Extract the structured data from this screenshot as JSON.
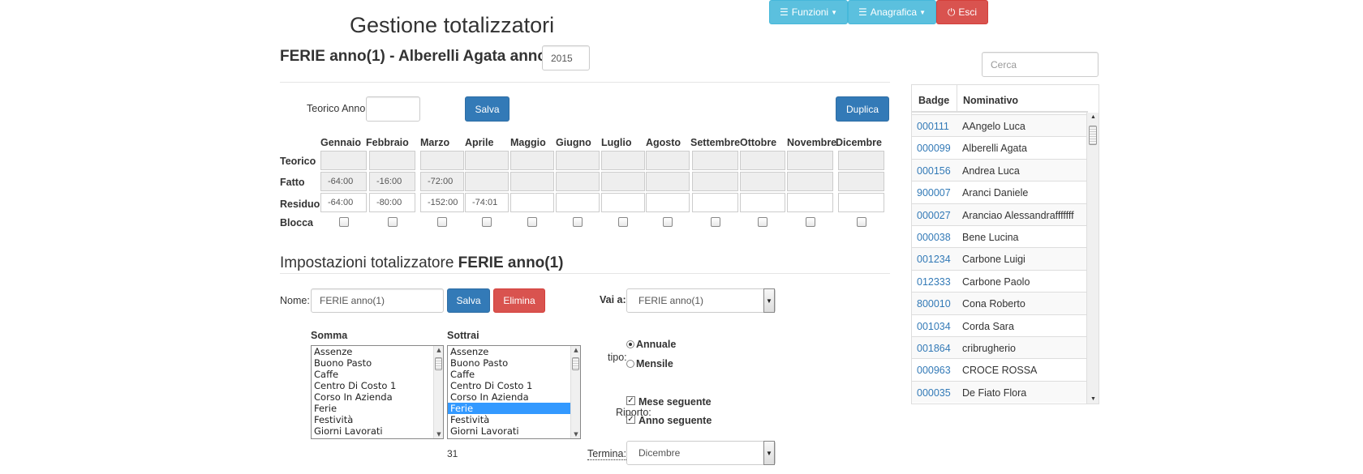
{
  "title": "Gestione totalizzatori",
  "navbar": {
    "funzioni": "Funzioni",
    "anagrafica": "Anagrafica",
    "esci": "Esci"
  },
  "heading": {
    "text": "FERIE anno(1) - Alberelli Agata anno",
    "year": "2015"
  },
  "teorico_anno": {
    "label": "Teorico Anno",
    "value": ""
  },
  "buttons": {
    "salva": "Salva",
    "duplica": "Duplica",
    "elimina": "Elimina"
  },
  "grid": {
    "months": [
      "Gennaio",
      "Febbraio",
      "Marzo",
      "Aprile",
      "Maggio",
      "Giugno",
      "Luglio",
      "Agosto",
      "Settembre",
      "Ottobre",
      "Novembre",
      "Dicembre"
    ],
    "row_labels": {
      "teorico": "Teorico",
      "fatto": "Fatto",
      "residuo": "Residuo",
      "blocca": "Blocca"
    },
    "teorico": [
      "",
      "",
      "",
      "",
      "",
      "",
      "",
      "",
      "",
      "",
      "",
      ""
    ],
    "fatto": [
      "-64:00",
      "-16:00",
      "-72:00",
      "",
      "",
      "",
      "",
      "",
      "",
      "",
      "",
      ""
    ],
    "residuo": [
      "-64:00",
      "-80:00",
      "-152:00",
      "-74:01",
      "",
      "",
      "",
      "",
      "",
      "",
      "",
      ""
    ]
  },
  "settings": {
    "title_prefix": "Impostazioni totalizzatore",
    "title_name": "FERIE anno(1)",
    "nome_label": "Nome:",
    "nome_value": "FERIE anno(1)",
    "vai_label": "Vai a:",
    "vai_value": "FERIE anno(1)",
    "somma_label": "Somma",
    "sottrai_label": "Sottrai",
    "somma_items": [
      "Assenze",
      "Buono Pasto",
      "Caffe",
      "Centro Di Costo 1",
      "Corso In Azienda",
      "Ferie",
      "Festività",
      "Giorni Lavorati"
    ],
    "sottrai_items": [
      "Assenze",
      "Buono Pasto",
      "Caffe",
      "Centro Di Costo 1",
      "Corso In Azienda",
      "Ferie",
      "Festività",
      "Giorni Lavorati"
    ],
    "sottrai_selected": "Ferie",
    "count": "31",
    "tipo_label": "tipo:",
    "tipo_annuale": "Annuale",
    "tipo_mensile": "Mensile",
    "tipo_selected": "Annuale",
    "riporto_label": "Riporto:",
    "mese_seguente": "Mese seguente",
    "anno_seguente": "Anno seguente",
    "termina_label": "Termina:",
    "termina_value": "Dicembre"
  },
  "search": {
    "placeholder": "Cerca"
  },
  "badge_table": {
    "headers": {
      "badge": "Badge",
      "nominativo": "Nominativo"
    },
    "rows": [
      {
        "badge": "000111",
        "name": "AAngelo Luca"
      },
      {
        "badge": "000099",
        "name": "Alberelli Agata"
      },
      {
        "badge": "000156",
        "name": "Andrea Luca"
      },
      {
        "badge": "900007",
        "name": "Aranci Daniele"
      },
      {
        "badge": "000027",
        "name": "Aranciao Alessandrafffffff"
      },
      {
        "badge": "000038",
        "name": "Bene Lucina"
      },
      {
        "badge": "001234",
        "name": "Carbone Luigi"
      },
      {
        "badge": "012333",
        "name": "Carbone Paolo"
      },
      {
        "badge": "800010",
        "name": "Cona Roberto"
      },
      {
        "badge": "001034",
        "name": "Corda Sara"
      },
      {
        "badge": "001864",
        "name": "cribrugherio"
      },
      {
        "badge": "000963",
        "name": "CROCE ROSSA"
      },
      {
        "badge": "000035",
        "name": "De Fiato Flora"
      }
    ]
  }
}
